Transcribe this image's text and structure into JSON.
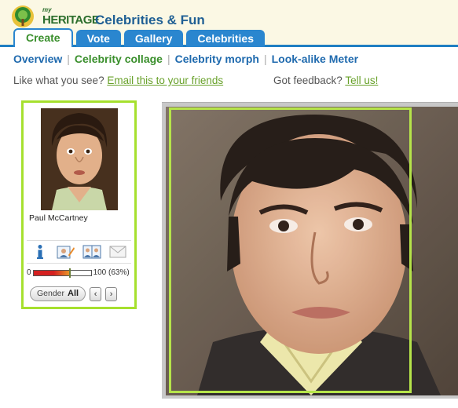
{
  "brand": {
    "logo_my": "my",
    "logo_text": "HERITAGE"
  },
  "app_title": "Celebrities & Fun",
  "tabs": [
    {
      "label": "Create",
      "active": true
    },
    {
      "label": "Vote"
    },
    {
      "label": "Gallery"
    },
    {
      "label": "Celebrities"
    }
  ],
  "subnav": [
    {
      "label": "Overview",
      "color": "#1f6aae"
    },
    {
      "label": "Celebrity collage",
      "color": "#3a8f2c"
    },
    {
      "label": "Celebrity morph",
      "color": "#1f6aae"
    },
    {
      "label": "Look-alike Meter",
      "color": "#1f6aae"
    }
  ],
  "share": {
    "prefix": "Like what you see?",
    "link": "Email this to your friends"
  },
  "feedback": {
    "prefix": "Got feedback?",
    "link": "Tell us!"
  },
  "celebrity": {
    "name": "Paul McCartney",
    "meter_min": "0",
    "meter_max_label": "100 (63%)",
    "match_fraction": 0.63
  },
  "actions": [
    {
      "icon": "info-icon"
    },
    {
      "icon": "edit-photo-icon"
    },
    {
      "icon": "compare-photos-icon"
    },
    {
      "icon": "email-icon"
    }
  ],
  "gender": {
    "label": "Gender",
    "value": "All"
  },
  "nav": {
    "prev": "‹",
    "next": "›"
  },
  "colors": {
    "accent_green": "#a6e02e",
    "tab_blue": "#2a86cf",
    "link_green": "#68a12a"
  }
}
